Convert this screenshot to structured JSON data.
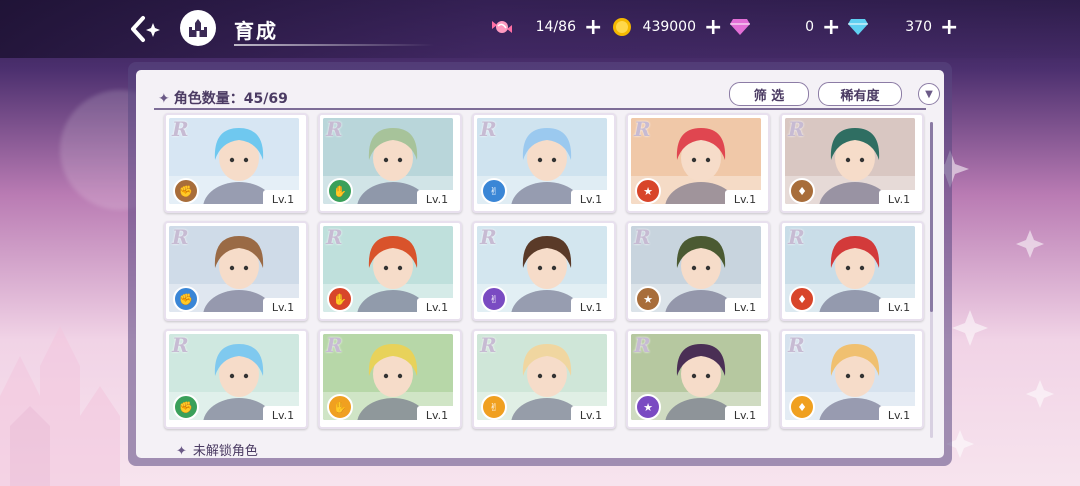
{
  "header": {
    "title": "育成"
  },
  "resources": [
    {
      "name": "candy",
      "icon": "candy-icon",
      "value": "14/86",
      "color": "#ff6fa4"
    },
    {
      "name": "gold",
      "icon": "coin-icon",
      "value": "439000",
      "color": "#f5b800"
    },
    {
      "name": "pink-gem",
      "icon": "pink-diamond-icon",
      "value": "0",
      "color": "#e36fd6"
    },
    {
      "name": "blue-gem",
      "icon": "blue-diamond-icon",
      "value": "370",
      "color": "#5fd0f2"
    }
  ],
  "panel": {
    "count_label": "角色数量：45/69",
    "filter_label": "筛 选",
    "rarity_label": "稀有度",
    "unlock_label": "未解锁角色"
  },
  "characters": [
    {
      "rank": "R",
      "level": "Lv.1",
      "attr_color": "#a86d3a",
      "hair": "#6fc8ef",
      "bg": "#d7e6f3"
    },
    {
      "rank": "R",
      "level": "Lv.1",
      "attr_color": "#3aa05a",
      "hair": "#a7c39a",
      "bg": "#b9d6da"
    },
    {
      "rank": "R",
      "level": "Lv.1",
      "attr_color": "#3a86d6",
      "hair": "#9bc9ef",
      "bg": "#cfe3ef"
    },
    {
      "rank": "R",
      "level": "Lv.1",
      "attr_color": "#d8452a",
      "hair": "#e04650",
      "bg": "#f0c8a8"
    },
    {
      "rank": "R",
      "level": "Lv.1",
      "attr_color": "#a86d3a",
      "hair": "#2f6e62",
      "bg": "#d9c7c2"
    },
    {
      "rank": "R",
      "level": "Lv.1",
      "attr_color": "#3a86d6",
      "hair": "#9a6a45",
      "bg": "#cfdbe8"
    },
    {
      "rank": "R",
      "level": "Lv.1",
      "attr_color": "#d8452a",
      "hair": "#d9532b",
      "bg": "#bfe0dc"
    },
    {
      "rank": "R",
      "level": "Lv.1",
      "attr_color": "#7a4bc2",
      "hair": "#5a3a28",
      "bg": "#d3e6ef"
    },
    {
      "rank": "R",
      "level": "Lv.1",
      "attr_color": "#a86d3a",
      "hair": "#4b5a32",
      "bg": "#c8d4de"
    },
    {
      "rank": "R",
      "level": "Lv.1",
      "attr_color": "#d8452a",
      "hair": "#d33a3a",
      "bg": "#c9dde8"
    },
    {
      "rank": "R",
      "level": "Lv.1",
      "attr_color": "#3aa05a",
      "hair": "#7fc9ef",
      "bg": "#cfe8e0"
    },
    {
      "rank": "R",
      "level": "Lv.1",
      "attr_color": "#f0a020",
      "hair": "#e8d25a",
      "bg": "#b7d7a8"
    },
    {
      "rank": "R",
      "level": "Lv.1",
      "attr_color": "#f0a020",
      "hair": "#f0d6a0",
      "bg": "#cfe6d8"
    },
    {
      "rank": "R",
      "level": "Lv.1",
      "attr_color": "#7a4bc2",
      "hair": "#4a2f55",
      "bg": "#b6c8a0"
    },
    {
      "rank": "R",
      "level": "Lv.1",
      "attr_color": "#f0a020",
      "hair": "#f0c070",
      "bg": "#d6e2ee"
    }
  ]
}
